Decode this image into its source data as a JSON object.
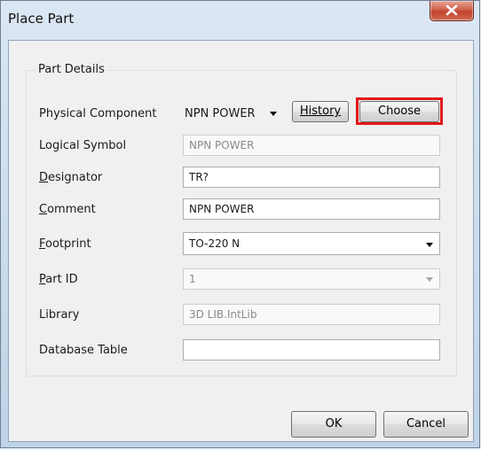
{
  "window": {
    "title": "Place Part"
  },
  "group": {
    "legend": "Part Details"
  },
  "physical_component": {
    "label": "Physical Component",
    "value": "NPN POWER"
  },
  "buttons": {
    "history": "History",
    "choose": "Choose",
    "ok": "OK",
    "cancel": "Cancel"
  },
  "fields": {
    "logical_symbol": {
      "label": "Logical Symbol",
      "value": "NPN POWER"
    },
    "designator": {
      "label_first": "D",
      "label_rest": "esignator",
      "value": "TR?"
    },
    "comment": {
      "label_first": "C",
      "label_rest": "omment",
      "value": "NPN POWER"
    },
    "footprint": {
      "label_first": "F",
      "label_rest": "ootprint",
      "value": "TO-220 N"
    },
    "part_id": {
      "label_first": "P",
      "label_rest": "art ID",
      "value": "1"
    },
    "library": {
      "label": "Library",
      "value": "3D LIB.IntLib"
    },
    "database_table": {
      "label": "Database Table",
      "value": ""
    }
  },
  "colors": {
    "highlight": "#e2171b",
    "close_button": "#c2412b"
  }
}
